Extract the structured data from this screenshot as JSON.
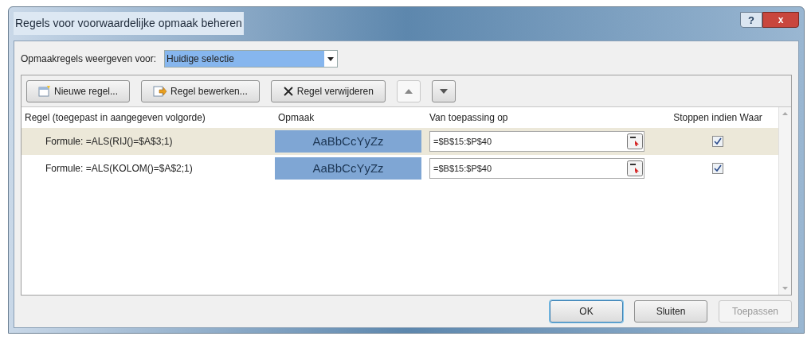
{
  "window": {
    "title": "Regels voor voorwaardelijke opmaak beheren",
    "help": "?",
    "close": "x"
  },
  "show_for": {
    "label": "Opmaakregels weergeven voor:",
    "value": "Huidige selectie"
  },
  "toolbar": [
    {
      "kind": "new",
      "label": "Nieuwe regel...",
      "disabled": false
    },
    {
      "kind": "edit",
      "label": "Regel bewerken...",
      "disabled": false
    },
    {
      "kind": "delete",
      "label": "Regel verwijderen",
      "disabled": false
    },
    {
      "kind": "up",
      "disabled": true
    },
    {
      "kind": "down",
      "disabled": false
    }
  ],
  "table": {
    "columns": [
      "Regel (toegepast in aangegeven volgorde)",
      "Opmaak",
      "Van toepassing op",
      "Stoppen indien Waar"
    ],
    "rows": [
      {
        "rule": "Formule: =ALS(RIJ()=$A$3;1)",
        "preview": "AaBbCcYyZz",
        "applies_to": "=$B$15:$P$40",
        "stop": true,
        "selected": true
      },
      {
        "rule": "Formule: =ALS(KOLOM()=$A$2;1)",
        "preview": "AaBbCcYyZz",
        "applies_to": "=$B$15:$P$40",
        "stop": true,
        "selected": false
      }
    ]
  },
  "buttons": [
    {
      "label": "OK",
      "default": true,
      "disabled": false
    },
    {
      "label": "Sluiten",
      "default": false,
      "disabled": false
    },
    {
      "label": "Toepassen",
      "default": false,
      "disabled": true
    }
  ]
}
